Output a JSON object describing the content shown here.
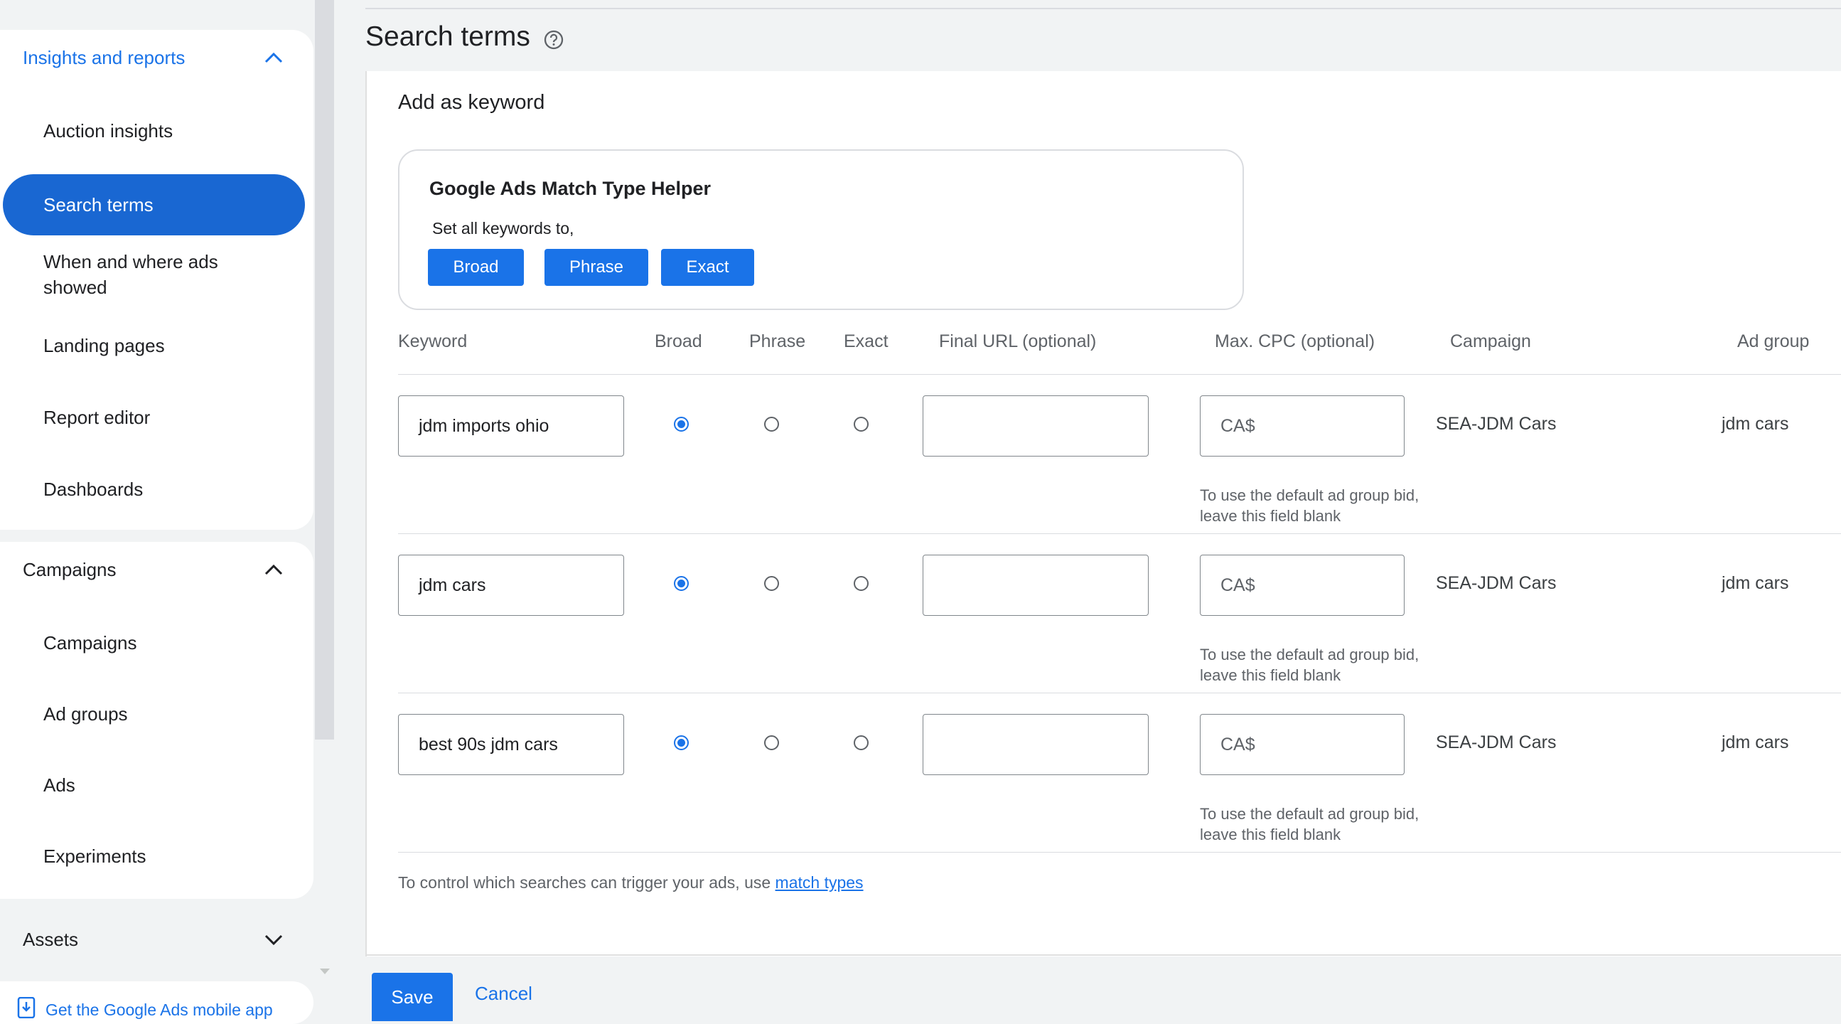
{
  "sidebar": {
    "insights": {
      "header": "Insights and reports",
      "items": [
        "Auction insights",
        "Search terms",
        "When and where ads showed",
        "Landing pages",
        "Report editor",
        "Dashboards"
      ],
      "active": "Search terms"
    },
    "campaigns": {
      "header": "Campaigns",
      "items": [
        "Campaigns",
        "Ad groups",
        "Ads",
        "Experiments"
      ]
    },
    "assets": {
      "header": "Assets"
    },
    "mobile_app": "Get the Google Ads mobile app"
  },
  "page": {
    "title": "Search terms",
    "panel_title": "Add as keyword"
  },
  "helper": {
    "title": "Google Ads Match Type Helper",
    "subtitle": "Set all keywords to,",
    "buttons": [
      "Broad",
      "Phrase",
      "Exact"
    ]
  },
  "table": {
    "headers": [
      "Keyword",
      "Broad",
      "Phrase",
      "Exact",
      "Final URL (optional)",
      "Max. CPC (optional)",
      "Campaign",
      "Ad group"
    ],
    "rows": [
      {
        "keyword": "jdm imports ohio",
        "match": "Broad",
        "final_url": "",
        "cpc_placeholder": "CA$",
        "cpc_help": "To use the default ad group bid, leave this field blank",
        "campaign": "SEA-JDM Cars",
        "ad_group": "jdm cars"
      },
      {
        "keyword": "jdm cars",
        "match": "Broad",
        "final_url": "",
        "cpc_placeholder": "CA$",
        "cpc_help": "To use the default ad group bid, leave this field blank",
        "campaign": "SEA-JDM Cars",
        "ad_group": "jdm cars"
      },
      {
        "keyword": "best 90s jdm cars",
        "match": "Broad",
        "final_url": "",
        "cpc_placeholder": "CA$",
        "cpc_help": "To use the default ad group bid, leave this field blank",
        "campaign": "SEA-JDM Cars",
        "ad_group": "jdm cars"
      }
    ]
  },
  "footnote": {
    "text": "To control which searches can trigger your ads, use ",
    "link": "match types"
  },
  "actions": {
    "save": "Save",
    "cancel": "Cancel"
  },
  "colors": {
    "accent": "#1a73e8",
    "active_nav": "#1967d2",
    "background": "#f1f3f4"
  },
  "icons": {
    "help": "help-circle-icon",
    "expanded": "chevron-up-icon",
    "collapsed": "chevron-down-icon",
    "mobile": "phone-download-icon"
  }
}
